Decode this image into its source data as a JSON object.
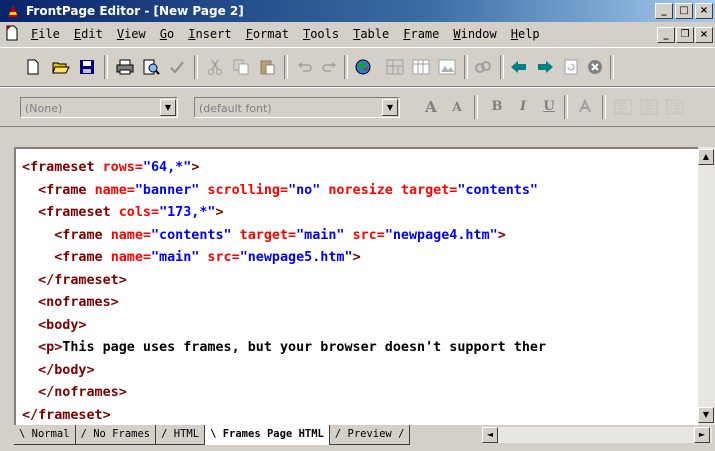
{
  "window": {
    "title": "FrontPage Editor - [New Page 2]",
    "minimize": "_",
    "maximize": "□",
    "close": "×"
  },
  "menu": {
    "items": [
      {
        "u": "F",
        "rest": "ile"
      },
      {
        "u": "E",
        "rest": "dit"
      },
      {
        "u": "V",
        "rest": "iew"
      },
      {
        "u": "G",
        "rest": "o"
      },
      {
        "u": "I",
        "rest": "nsert"
      },
      {
        "u": "F",
        "rest": "ormat"
      },
      {
        "u": "T",
        "rest": "ools"
      },
      {
        "u": "T",
        "rest": "able",
        "prefix": ""
      },
      {
        "u": "F",
        "rest": "rame"
      },
      {
        "u": "W",
        "rest": "indow"
      },
      {
        "u": "H",
        "rest": "elp"
      }
    ],
    "mdi_minimize": "_",
    "mdi_restore": "❐",
    "mdi_close": "×"
  },
  "format_toolbar": {
    "style_combo": "(None)",
    "font_combo": "(default font)",
    "combo_arrow": "▼",
    "grow_font": "A",
    "shrink_font": "A",
    "bold": "B",
    "italic": "I",
    "underline": "U"
  },
  "editor": {
    "lines": [
      [
        {
          "c": "tag",
          "t": "<frameset "
        },
        {
          "c": "attr",
          "t": "rows="
        },
        {
          "c": "val",
          "t": "\"64,*\""
        },
        {
          "c": "tag",
          "t": ">"
        }
      ],
      [
        {
          "c": "tag",
          "t": "  <frame "
        },
        {
          "c": "attr",
          "t": "name="
        },
        {
          "c": "val",
          "t": "\"banner\""
        },
        {
          "c": "attr",
          "t": " scrolling="
        },
        {
          "c": "val",
          "t": "\"no\""
        },
        {
          "c": "attr",
          "t": " noresize target="
        },
        {
          "c": "val",
          "t": "\"contents\""
        }
      ],
      [
        {
          "c": "tag",
          "t": "  <frameset "
        },
        {
          "c": "attr",
          "t": "cols="
        },
        {
          "c": "val",
          "t": "\"173,*\""
        },
        {
          "c": "tag",
          "t": ">"
        }
      ],
      [
        {
          "c": "tag",
          "t": "    <frame "
        },
        {
          "c": "attr",
          "t": "name="
        },
        {
          "c": "val",
          "t": "\"contents\""
        },
        {
          "c": "attr",
          "t": " target="
        },
        {
          "c": "val",
          "t": "\"main\""
        },
        {
          "c": "attr",
          "t": " src="
        },
        {
          "c": "val",
          "t": "\"newpage4.htm\""
        },
        {
          "c": "tag",
          "t": ">"
        }
      ],
      [
        {
          "c": "tag",
          "t": "    <frame "
        },
        {
          "c": "attr",
          "t": "name="
        },
        {
          "c": "val",
          "t": "\"main\""
        },
        {
          "c": "attr",
          "t": " src="
        },
        {
          "c": "val",
          "t": "\"newpage5.htm\""
        },
        {
          "c": "tag",
          "t": ">"
        }
      ],
      [
        {
          "c": "tag",
          "t": "  </frameset>"
        }
      ],
      [
        {
          "c": "tag",
          "t": "  <noframes>"
        }
      ],
      [
        {
          "c": "tag",
          "t": "  <body>"
        }
      ],
      [
        {
          "c": "tag",
          "t": "  <p>"
        },
        {
          "c": "txt",
          "t": "This page uses frames, but your browser doesn't support ther"
        }
      ],
      [
        {
          "c": "tag",
          "t": "  </body>"
        }
      ],
      [
        {
          "c": "tag",
          "t": "  </noframes>"
        }
      ],
      [
        {
          "c": "tag",
          "t": "</frameset>"
        }
      ]
    ]
  },
  "scrollbar": {
    "up": "▲",
    "down": "▼",
    "left": "◄",
    "right": "►"
  },
  "tabs": [
    {
      "label": "\\ Normal "
    },
    {
      "label": "/ No Frames "
    },
    {
      "label": "/ HTML "
    },
    {
      "label": "\\ Frames Page HTML ",
      "active": true
    },
    {
      "label": "/ Preview /"
    }
  ]
}
